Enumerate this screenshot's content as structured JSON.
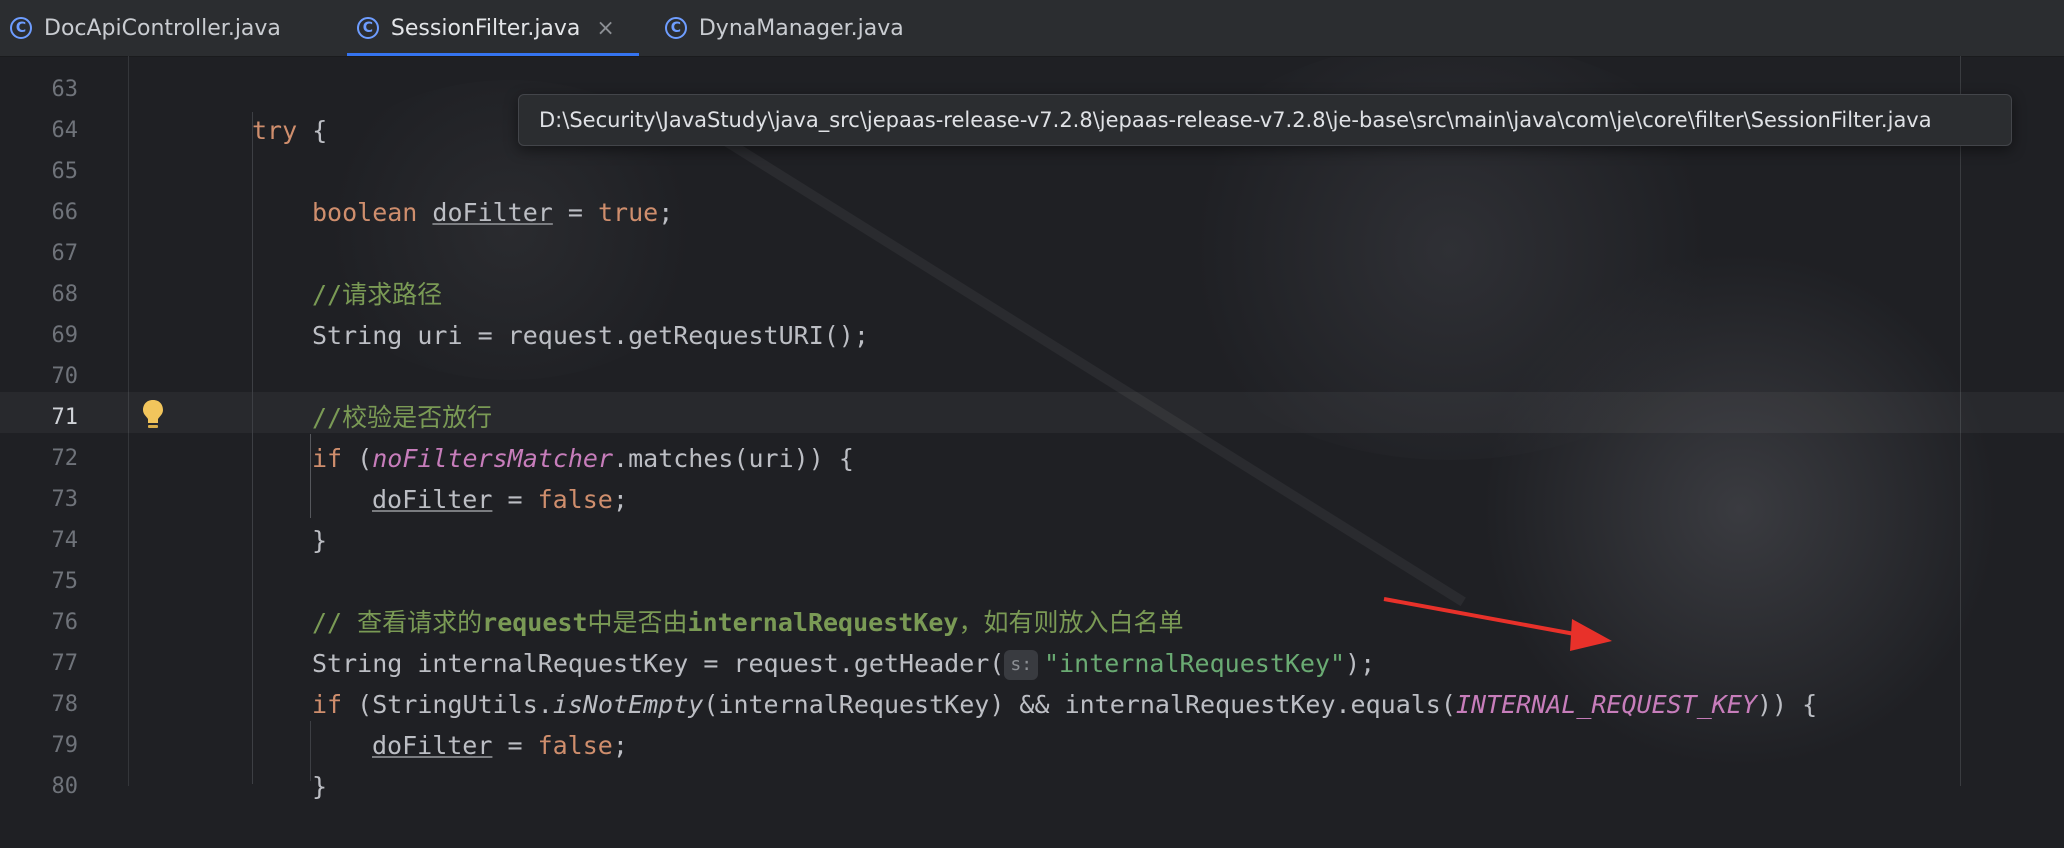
{
  "tabs": [
    {
      "label": "DocApiController.java",
      "icon": "class-icon",
      "active": false
    },
    {
      "label": "SessionFilter.java",
      "icon": "class-icon",
      "active": true
    },
    {
      "label": "DynaManager.java",
      "icon": "class-icon",
      "active": false
    }
  ],
  "tab_close_glyph": "×",
  "class_icon_glyph": "C",
  "tooltip": {
    "path": "D:\\Security\\JavaStudy\\java_src\\jepaas-release-v7.2.8\\jepaas-release-v7.2.8\\je-base\\src\\main\\java\\com\\je\\core\\filter\\SessionFilter.java"
  },
  "editor": {
    "current_line": "71",
    "line_numbers": [
      "63",
      "64",
      "65",
      "66",
      "67",
      "68",
      "69",
      "70",
      "71",
      "72",
      "73",
      "74",
      "75",
      "76",
      "77",
      "78",
      "79",
      "80"
    ],
    "code": {
      "l63_kw": "try",
      "l63_rest": " {",
      "l65_type": "boolean",
      "l65_var": "doFilter",
      "l65_eq": " = ",
      "l65_val": "true",
      "l65_end": ";",
      "l67_comment": "//请求路径",
      "l68_text": "String uri = request.getRequestURI();",
      "l70_comment": "//校验是否放行",
      "l71_kw": "if",
      "l71_open": " (",
      "l71_field": "noFiltersMatcher",
      "l71_rest": ".matches(uri)) {",
      "l72_var": "doFilter",
      "l72_eq": " = ",
      "l72_val": "false",
      "l72_end": ";",
      "l73_text": "}",
      "l75_comment_a": "// 查看请求的",
      "l75_comment_b": "request",
      "l75_comment_c": "中是否由",
      "l75_comment_d": "internalRequestKey",
      "l75_comment_e": "，如有则放入白名单",
      "l76_text": "String internalRequestKey = request.getHeader(",
      "l76_hint": "s:",
      "l76_str": "\"internalRequestKey\"",
      "l76_end": ");",
      "l77_kw": "if",
      "l77_a": " (StringUtils.",
      "l77_ital": "isNotEmpty",
      "l77_b": "(internalRequestKey) && internalRequestKey.equals(",
      "l77_field": "INTERNAL_REQUEST_KEY",
      "l77_end": ")) {",
      "l78_var": "doFilter",
      "l78_eq": " = ",
      "l78_val": "false",
      "l78_end": ";",
      "l79_text": "}"
    }
  },
  "colors": {
    "keyword": "#cf8e6d",
    "string": "#6aab73",
    "comment": "#7a9a55",
    "field": "#c77dbb",
    "annotation_arrow": "#e8312a",
    "tab_underline": "#3574f0"
  }
}
